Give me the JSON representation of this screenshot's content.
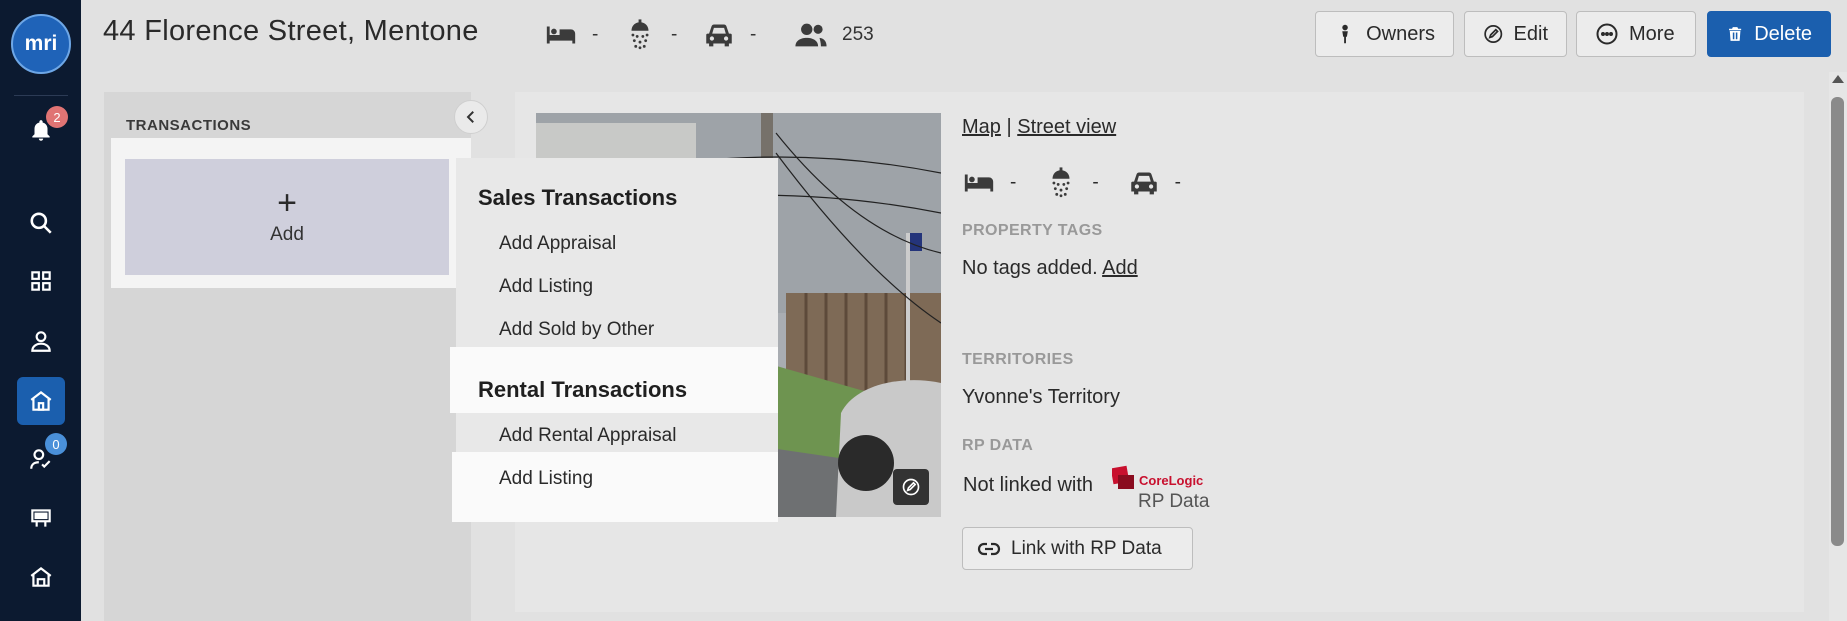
{
  "app": {
    "logo_text": "mri"
  },
  "rail": {
    "notifications_badge": "2",
    "tasks_badge": "0",
    "items": [
      "bell-icon",
      "search-icon",
      "grid-icon",
      "person-icon",
      "house-icon",
      "tasks-icon",
      "billboard-icon",
      "home-outline-icon"
    ]
  },
  "header": {
    "title": "44 Florence Street, Mentone",
    "bedrooms": "-",
    "bathrooms": "-",
    "car_spaces": "-",
    "contacts_count": "253",
    "buttons": {
      "owners": "Owners",
      "edit": "Edit",
      "more": "More",
      "delete": "Delete"
    }
  },
  "transactions": {
    "title": "TRANSACTIONS",
    "add_label": "Add"
  },
  "menu": {
    "sales_heading": "Sales Transactions",
    "sales_items": [
      "Add Appraisal",
      "Add Listing",
      "Add Sold by Other"
    ],
    "rental_heading": "Rental Transactions",
    "rental_items": [
      "Add Rental Appraisal",
      "Add Listing"
    ]
  },
  "property": {
    "map_link": "Map",
    "separator": "|",
    "street_view_link": "Street view",
    "bedrooms": "-",
    "bathrooms": "-",
    "car_spaces": "-",
    "tags_label": "PROPERTY TAGS",
    "tags_text": "No tags added.",
    "tags_add_link": "Add",
    "territories_label": "TERRITORIES",
    "territory": "Yvonne's Territory",
    "rp_label": "RP DATA",
    "rp_status": "Not linked with",
    "corelogic_brand": "CoreLogic",
    "corelogic_product": "RP Data",
    "rp_button": "Link with RP Data"
  },
  "colors": {
    "primary": "#1b5fae",
    "rail": "#0c1a30",
    "badge_red": "#e07474",
    "badge_blue": "#4a90d9"
  }
}
